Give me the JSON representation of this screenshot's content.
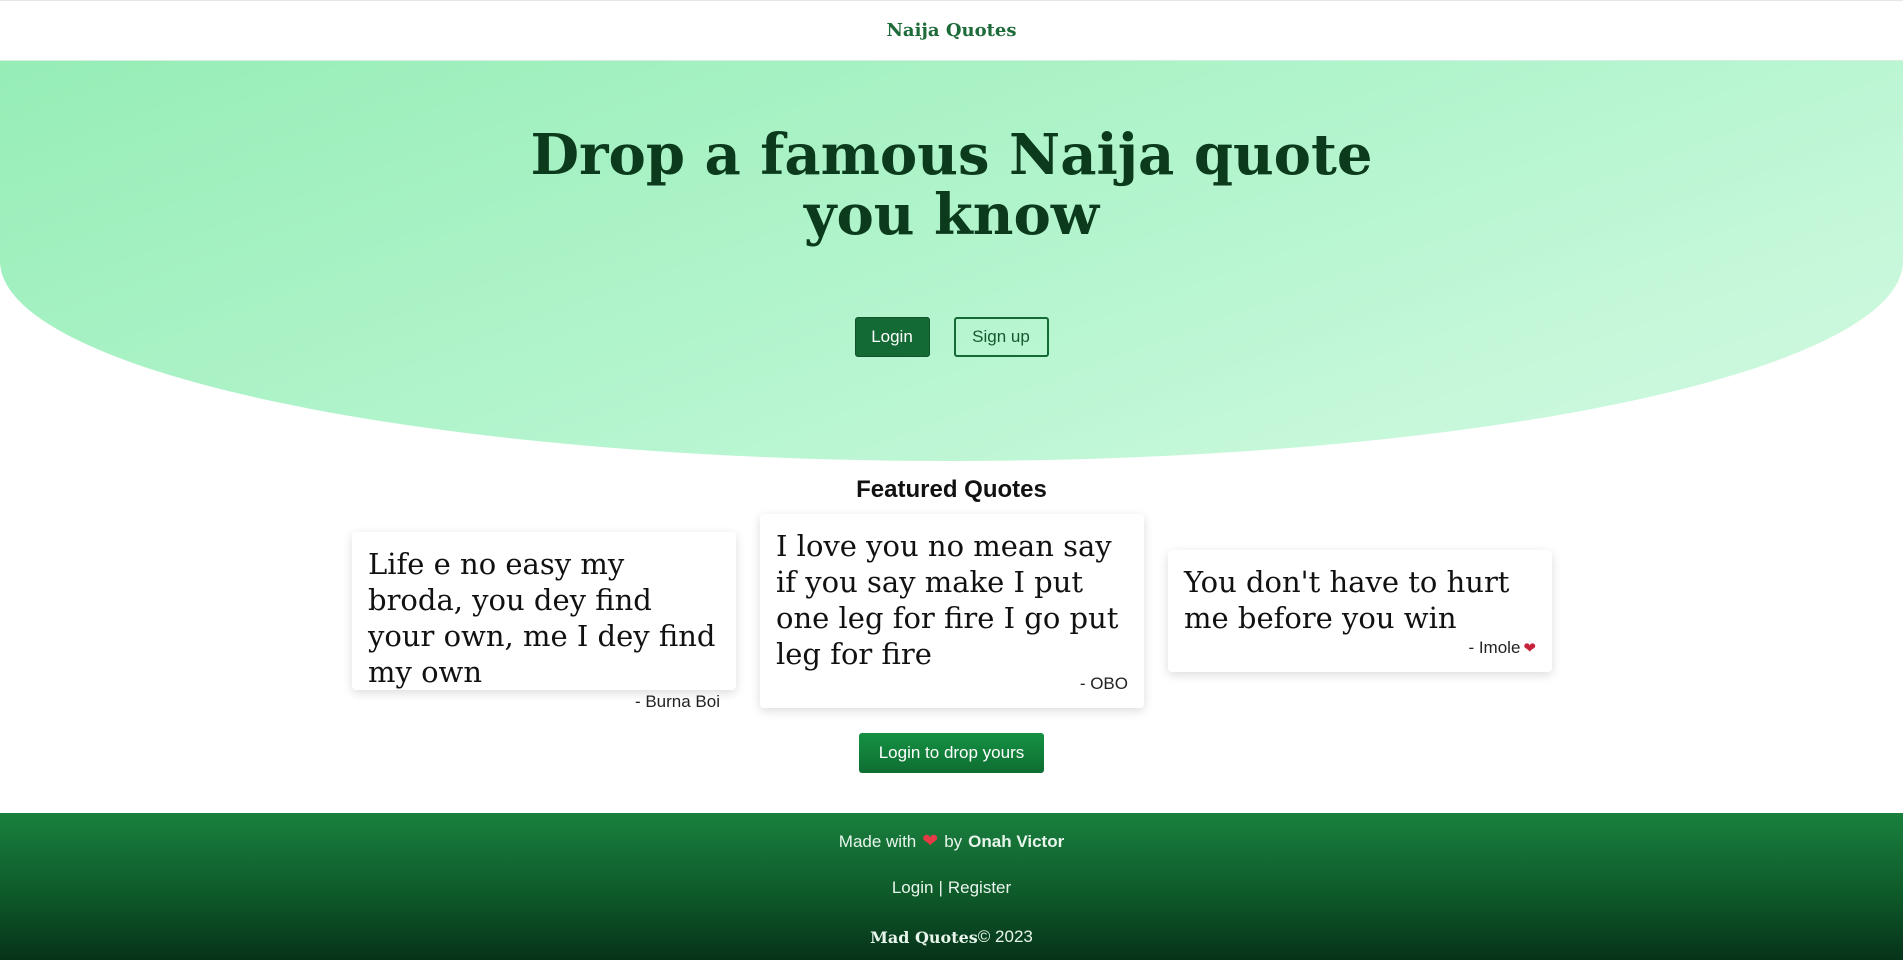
{
  "header": {
    "brand": "Naija Quotes"
  },
  "hero": {
    "title_line1": "Drop a famous Naija quote",
    "title_line2": "you know",
    "login_label": "Login",
    "signup_label": "Sign up"
  },
  "featured": {
    "title": "Featured Quotes",
    "quotes": [
      {
        "text": "Life e no easy my broda, you dey find your own, me I dey find my own",
        "author": "- Burna Boi"
      },
      {
        "text": "I love you no mean say if you say make I put one leg for fire I go put leg for fire",
        "author": "- OBO"
      },
      {
        "text": "You don't have to hurt me before you win",
        "author": "- Imole",
        "badge_icon": "heart-pulse-icon"
      }
    ],
    "cta_label": "Login to drop yours"
  },
  "footer": {
    "made_with": "Made with",
    "by": "by",
    "author": "Onah Victor",
    "login_link": "Login",
    "separator": "|",
    "register_link": "Register",
    "brand": "Mad Quotes",
    "copyright": "© 2023"
  },
  "colors": {
    "brand_green": "#136a34",
    "hero_gradient_start": "#96edb6",
    "hero_gradient_end": "#d4fae3",
    "footer_dark": "#06331a",
    "heart": "#e63b46"
  }
}
